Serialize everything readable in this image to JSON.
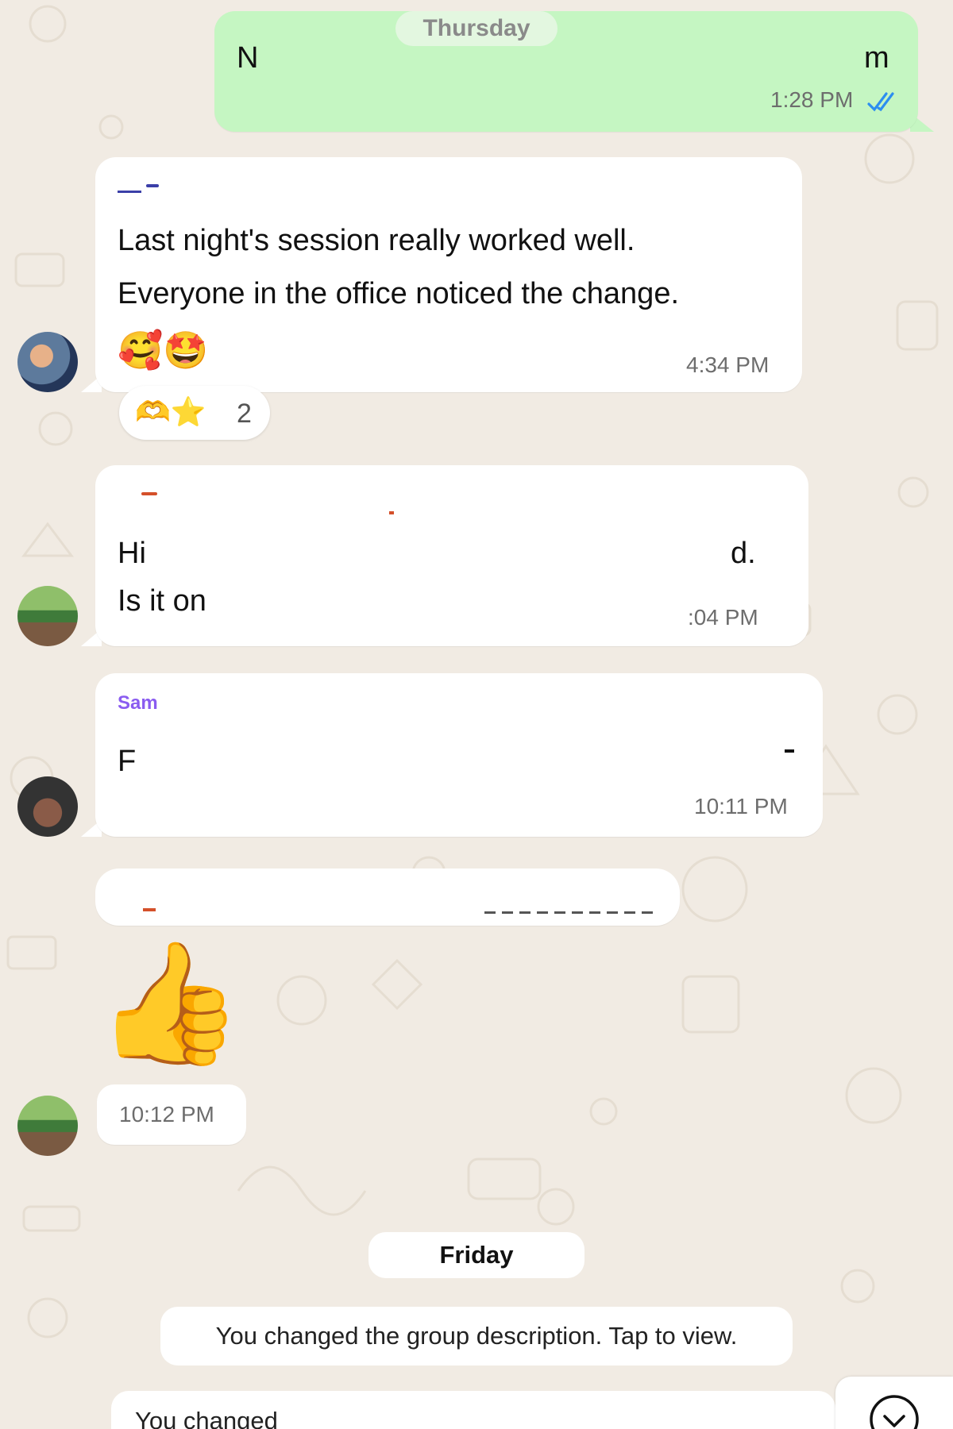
{
  "days": {
    "thursday": "Thursday",
    "friday": "Friday"
  },
  "outgoing": {
    "text_left": "N",
    "text_right": "m",
    "time": "1:28 PM",
    "status_icon": "double-check-read-icon"
  },
  "messages": [
    {
      "sender": "",
      "sender_color": "#3b3fa8",
      "line1": "Last night's session really worked well.",
      "line2": "Everyone in the office noticed the change.",
      "emoji": "🥰🤩",
      "time": "4:34 PM",
      "reactions": {
        "emoji": "🫶⭐",
        "count": "2"
      }
    },
    {
      "sender": "",
      "sender_color": "#d4502a",
      "line1_left": "Hi",
      "line1_right": "d.",
      "line2": "Is it on",
      "time": ":04 PM"
    },
    {
      "sender": "Sam",
      "sender_color": "#8a5cf0",
      "line1_left": "F",
      "time": "10:11 PM"
    },
    {
      "sender": "",
      "sender_color": "#d4502a"
    },
    {
      "sticker": "👍",
      "time": "10:12 PM"
    }
  ],
  "system": {
    "description_changed": "You changed the group description. Tap to view.",
    "partial": "You changed"
  },
  "scroll_button": {
    "icon": "chevron-down-icon"
  },
  "colors": {
    "background": "#f1ebe3",
    "outgoing_bubble": "#c5f6c2",
    "incoming_bubble": "#ffffff",
    "read_ticks": "#2c8ef0"
  }
}
